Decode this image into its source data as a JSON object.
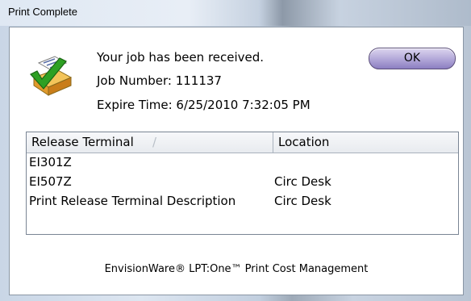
{
  "window": {
    "title": "Print Complete"
  },
  "message": {
    "line1": "Your job has been received.",
    "line2": "Job Number: 111137",
    "line3": "Expire Time: 6/25/2010 7:32:05 PM"
  },
  "ok_label": "OK",
  "table": {
    "columns": [
      "Release Terminal",
      "Location"
    ],
    "sort_indicator": "/",
    "rows": [
      [
        "EI301Z",
        ""
      ],
      [
        "EI507Z",
        "Circ Desk"
      ],
      [
        "Print Release Terminal Description",
        "Circ Desk"
      ]
    ]
  },
  "footer": "EnvisionWare® LPT:One™ Print Cost Management",
  "icons": {
    "app": "print-checkmark-icon"
  }
}
